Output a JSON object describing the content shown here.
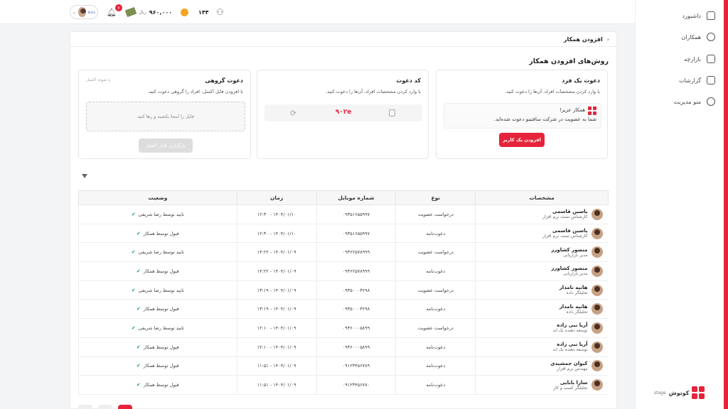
{
  "topbar": {
    "user_label": "Nima",
    "notification_count": "۷",
    "balance": "۹۶۰,۰۰۰",
    "currency": "ریال",
    "coins": "۱۴۴"
  },
  "sidebar": {
    "items": [
      {
        "label": "داشبورد",
        "icon": "home-icon"
      },
      {
        "label": "همکاران",
        "icon": "users-icon"
      },
      {
        "label": "بازارچه",
        "icon": "cart-icon"
      },
      {
        "label": "گزارشات",
        "icon": "chart-icon"
      },
      {
        "label": "منو مدیریت",
        "icon": "settings-icon"
      }
    ],
    "logo_text": "کوتوش",
    "logo_suffix": "stage"
  },
  "breadcrumb": {
    "title": "افزودن همکار"
  },
  "section_title": "روش‌های افزودن همکار",
  "cards": {
    "individual": {
      "title": "دعوت یک فرد",
      "desc": "با وارد کردن مشخصات افراد، آن‌ها را دعوت کنید.",
      "invite_line1": "همکار عزیز!",
      "invite_line2": "شما به عضویت در شرکت سافتینو دعوت شده‌اید.",
      "button": "افزودن یک کاربر"
    },
    "code": {
      "title": "کد دعوت",
      "desc": "با وارد کردن مشخصات افراد، آن‌ها را دعوت کنید.",
      "code": "۹۰۲e"
    },
    "group": {
      "title": "دعوت گروهی",
      "desc": "با افزودن فایل اکسل، افراد را گروهی دعوت کنید.",
      "sample": "نمونه اکسل",
      "dropzone": "فایل را اینجا بکشید و رها کنید",
      "upload": "بارگزاری فایل اکسل"
    }
  },
  "table": {
    "headers": [
      "مشخصات",
      "نوع",
      "شماره موبایل",
      "زمان",
      "وضعیت"
    ],
    "rows": [
      {
        "name": "یاسین قاسمی",
        "role": "کارشناس تست نرم افزار",
        "type": "درخواست عضویت",
        "mobile": "۰۹۳۵۱۶۵۵۹۹۷",
        "time": "۱۴۰۴/۰۱/۱۰ - ۱۲:۳۰",
        "status": "تایید توسط رضا شریفی"
      },
      {
        "name": "یاسین قاسمی",
        "role": "کارشناس تست نرم افزار",
        "type": "دعوت‌نامه",
        "mobile": "۰۹۳۵۱۶۵۵۹۹۷",
        "time": "۱۴۰۴/۰۱/۱۰ - ۱۲:۳۰",
        "status": "قبول توسط همکار"
      },
      {
        "name": "منصور کشاورز",
        "role": "مدیر بازاریابی",
        "type": "درخواست عضویت",
        "mobile": "۰۹۳۶۲۵۷۸۹۹۹",
        "time": "۱۴۰۴/۰۱/۰۹ - ۱۴:۲۲",
        "status": "تایید توسط رضا شریفی"
      },
      {
        "name": "منصور کشاورز",
        "role": "مدیر بازاریابی",
        "type": "دعوت‌نامه",
        "mobile": "۰۹۳۶۲۵۷۸۹۹۹",
        "time": "۱۴۰۴/۰۱/۰۹ - ۱۴:۲۲",
        "status": "قبول توسط همکار"
      },
      {
        "name": "هانیه نامدار",
        "role": "تحلیلگر داده",
        "type": "درخواست عضویت",
        "mobile": "۰۹۳۵۰۰۰۳۶۹۸",
        "time": "۱۴۰۴/۰۱/۰۹ - ۱۳:۱۹",
        "status": "تایید توسط رضا شریفی"
      },
      {
        "name": "هانیه نامدار",
        "role": "تحلیلگر داده",
        "type": "دعوت‌نامه",
        "mobile": "۰۹۳۵۰۰۰۳۶۹۸",
        "time": "۱۴۰۴/۰۱/۰۹ - ۱۳:۱۹",
        "status": "قبول توسط همکار"
      },
      {
        "name": "آریا نبی زاده",
        "role": "توسعه دهنده بک اند",
        "type": "درخواست عضویت",
        "mobile": "۰۹۳۶۰۰۰۵۸۹۹",
        "time": "۱۴۰۴/۰۱/۰۹ - ۱۲:۱۰",
        "status": "تایید توسط رضا شریفی"
      },
      {
        "name": "آریا نبی زاده",
        "role": "توسعه دهنده بک اند",
        "type": "دعوت‌نامه",
        "mobile": "۰۹۳۶۰۰۰۵۸۹۹",
        "time": "۱۴۰۴/۰۱/۰۹ - ۱۲:۱۰",
        "status": "قبول توسط همکار"
      },
      {
        "name": "کیوان جمشیدی",
        "role": "مهندس نرم افزار",
        "type": "دعوت‌نامه",
        "mobile": "۰۹۱۲۳۴۵۶۷۸۹",
        "time": "۱۴۰۴/۰۱/۰۹ - ۱۱:۵۱",
        "status": "قبول توسط همکار"
      },
      {
        "name": "سارا بابایی",
        "role": "تحلیلگر کسب و کار",
        "type": "دعوت‌نامه",
        "mobile": "۰۹۱۲۳۴۵۶۷۸۰",
        "time": "۱۴۰۴/۰۱/۰۹ - ۱۱:۵۱",
        "status": "قبول توسط همکار"
      }
    ]
  },
  "colors": {
    "accent": "#e5243b",
    "success": "#1aa260"
  }
}
